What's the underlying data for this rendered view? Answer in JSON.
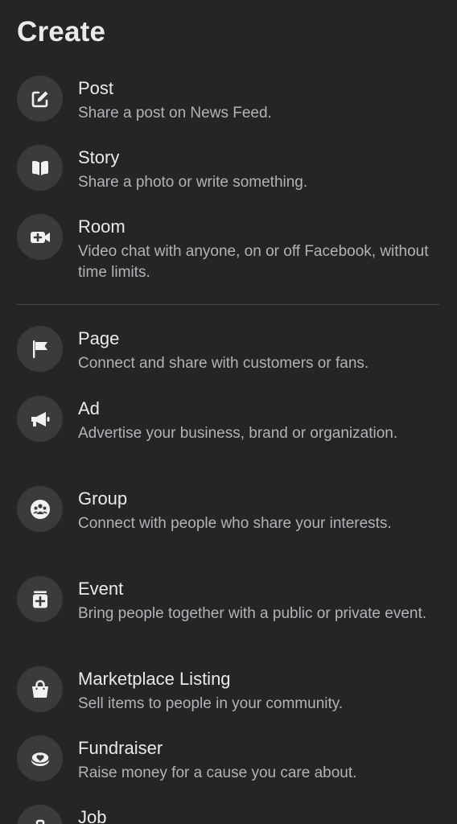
{
  "header": {
    "title": "Create"
  },
  "items": [
    {
      "title": "Post",
      "desc": "Share a post on News Feed.",
      "icon": "compose-icon"
    },
    {
      "title": "Story",
      "desc": "Share a photo or write something.",
      "icon": "book-icon"
    },
    {
      "title": "Room",
      "desc": "Video chat with anyone, on or off Facebook, without time limits.",
      "icon": "video-camera-plus-icon"
    },
    {
      "title": "Page",
      "desc": "Connect and share with customers or fans.",
      "icon": "flag-icon"
    },
    {
      "title": "Ad",
      "desc": "Advertise your business, brand or organization.",
      "icon": "megaphone-icon"
    },
    {
      "title": "Group",
      "desc": "Connect with people who share your interests.",
      "icon": "group-icon"
    },
    {
      "title": "Event",
      "desc": "Bring people together with a public or private event.",
      "icon": "calendar-plus-icon"
    },
    {
      "title": "Marketplace Listing",
      "desc": "Sell items to people in your community.",
      "icon": "shopping-bag-icon"
    },
    {
      "title": "Fundraiser",
      "desc": "Raise money for a cause you care about.",
      "icon": "heart-coin-icon"
    },
    {
      "title": "Job",
      "icon": "briefcase-icon"
    }
  ]
}
